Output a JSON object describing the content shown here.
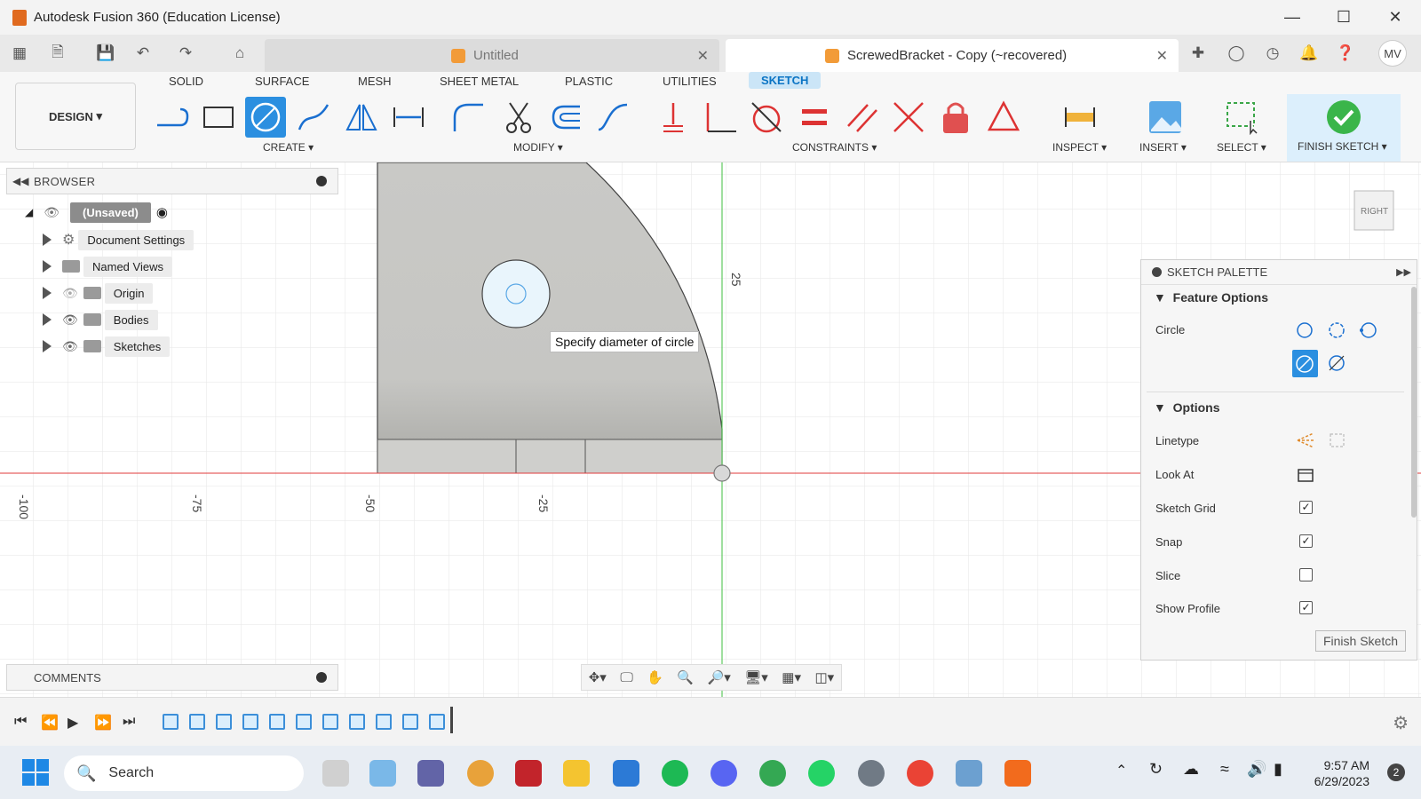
{
  "window": {
    "title": "Autodesk Fusion 360 (Education License)",
    "minimize_icon": "minimize-icon",
    "maximize_icon": "maximize-icon",
    "close_icon": "close-icon"
  },
  "tabs": [
    {
      "label": "Untitled",
      "active": false
    },
    {
      "label": "ScrewedBracket - Copy (~recovered)",
      "active": true
    }
  ],
  "user_initials": "MV",
  "ribbon": {
    "workspace": "DESIGN",
    "tabs": [
      "SOLID",
      "SURFACE",
      "MESH",
      "SHEET METAL",
      "PLASTIC",
      "UTILITIES",
      "SKETCH"
    ],
    "selected_tab": "SKETCH",
    "groups": [
      "CREATE",
      "MODIFY",
      "CONSTRAINTS",
      "INSPECT",
      "INSERT",
      "SELECT",
      "FINISH SKETCH"
    ]
  },
  "browser": {
    "title": "BROWSER",
    "root": "(Unsaved)",
    "items": [
      "Document Settings",
      "Named Views",
      "Origin",
      "Bodies",
      "Sketches"
    ]
  },
  "comments": {
    "title": "COMMENTS"
  },
  "canvas": {
    "tooltip": "Specify diameter of circle",
    "axis_labels": [
      "-100",
      "-75",
      "-50",
      "-25",
      "25"
    ],
    "viewcube_face": "RIGHT"
  },
  "palette": {
    "title": "SKETCH PALETTE",
    "feature_options_title": "Feature Options",
    "circle_label": "Circle",
    "options_title": "Options",
    "options": [
      {
        "label": "Linetype"
      },
      {
        "label": "Look At"
      },
      {
        "label": "Sketch Grid",
        "checked": true
      },
      {
        "label": "Snap",
        "checked": true
      },
      {
        "label": "Slice",
        "checked": false
      },
      {
        "label": "Show Profile",
        "checked": true
      }
    ],
    "finish_label": "Finish Sketch"
  },
  "taskbar": {
    "search_placeholder": "Search",
    "time": "9:57 AM",
    "date": "6/29/2023",
    "notifications": "2"
  },
  "colors": {
    "accent": "#2b8fe0",
    "x_axis": "#e23b3b",
    "y_axis": "#3fbf3f",
    "body": "#c8c8c5"
  }
}
